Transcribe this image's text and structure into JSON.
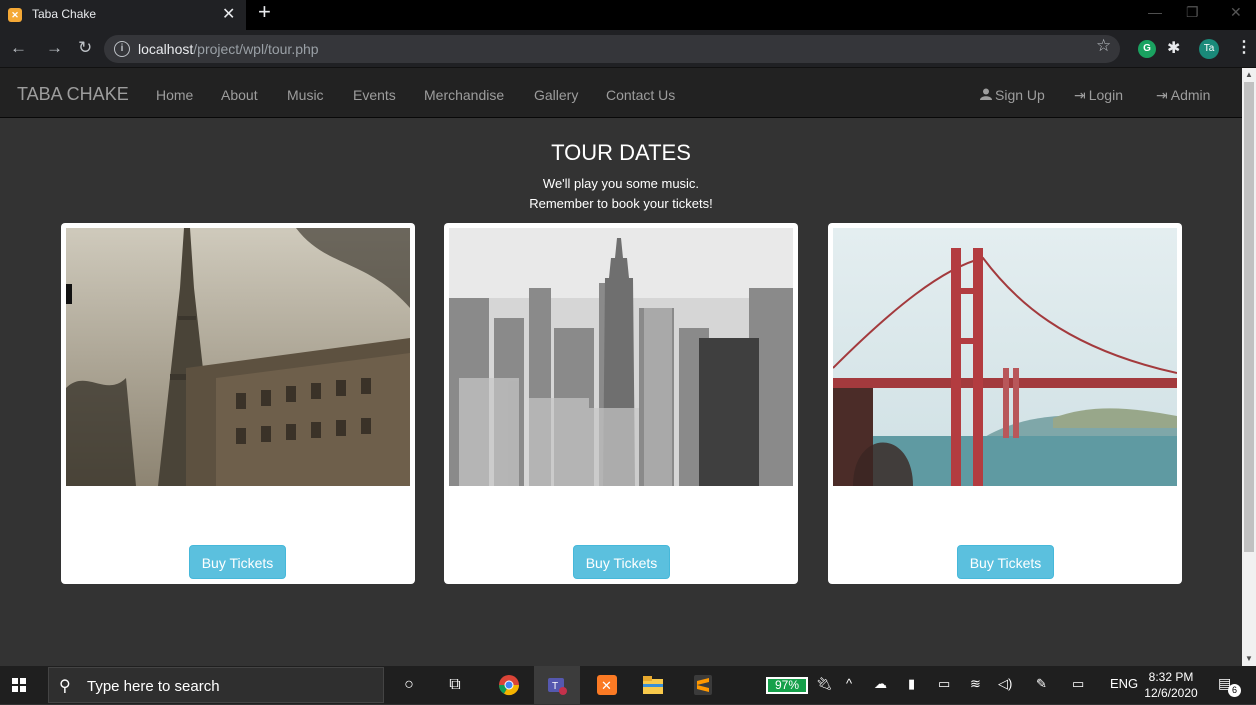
{
  "browser": {
    "tab_title": "Taba Chake",
    "tab_favicon_glyph": "xampp-icon",
    "url_host": "localhost",
    "url_path": "/project/wpl/tour.php",
    "profile_initials": "Ta",
    "extension_letter": "G"
  },
  "navbar": {
    "brand": "TABA CHAKE",
    "links": [
      "Home",
      "About",
      "Music",
      "Events",
      "Merchandise",
      "Gallery",
      "Contact Us"
    ],
    "signup": "Sign Up",
    "login": "Login",
    "admin": "Admin"
  },
  "page": {
    "title": "TOUR DATES",
    "subtitle_line1": "We'll play you some music.",
    "subtitle_line2": "Remember to book your tickets!"
  },
  "cards": [
    {
      "image": "paris-eiffel-tower-photo",
      "button": "Buy Tickets"
    },
    {
      "image": "new-york-skyline-photo",
      "button": "Buy Tickets"
    },
    {
      "image": "golden-gate-bridge-photo",
      "button": "Buy Tickets"
    }
  ],
  "taskbar": {
    "search_placeholder": "Type here to search",
    "battery": "97%",
    "language": "ENG",
    "time": "8:32 PM",
    "date": "12/6/2020",
    "notification_count": "6"
  },
  "colors": {
    "page_bg": "#333333",
    "navbar_bg": "#222222",
    "button_info": "#5bc0de"
  }
}
